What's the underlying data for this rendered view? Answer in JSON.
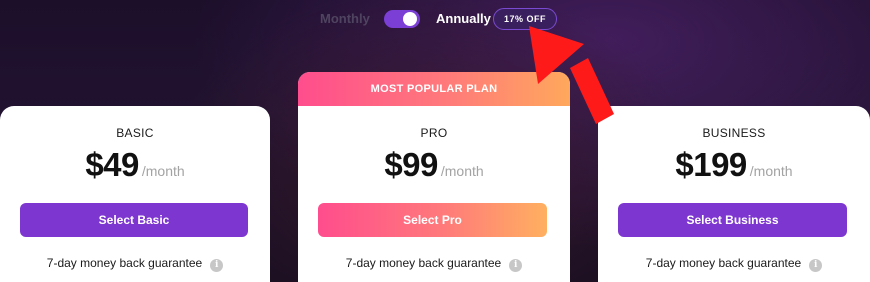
{
  "billing_toggle": {
    "monthly_label": "Monthly",
    "annually_label": "Annually",
    "selected": "Annually",
    "discount_badge": "17% OFF"
  },
  "plans": [
    {
      "name": "BASIC",
      "price": "$49",
      "period": "/month",
      "button_label": "Select Basic",
      "guarantee": "7-day money back guarantee",
      "featured": false
    },
    {
      "name": "PRO",
      "price": "$99",
      "period": "/month",
      "button_label": "Select Pro",
      "guarantee": "7-day money back guarantee",
      "featured": true,
      "banner": "MOST POPULAR PLAN"
    },
    {
      "name": "BUSINESS",
      "price": "$199",
      "period": "/month",
      "button_label": "Select Business",
      "guarantee": "7-day money back guarantee",
      "featured": false
    }
  ],
  "icons": {
    "info": "info-icon",
    "annotation": "red-arrow-icon"
  },
  "colors": {
    "accent_purple": "#7d36d0",
    "gradient_start": "#ff4d8d",
    "gradient_end": "#ffb060",
    "annotation_red": "#ff1a1a",
    "background_dark": "#1c0f2a"
  }
}
